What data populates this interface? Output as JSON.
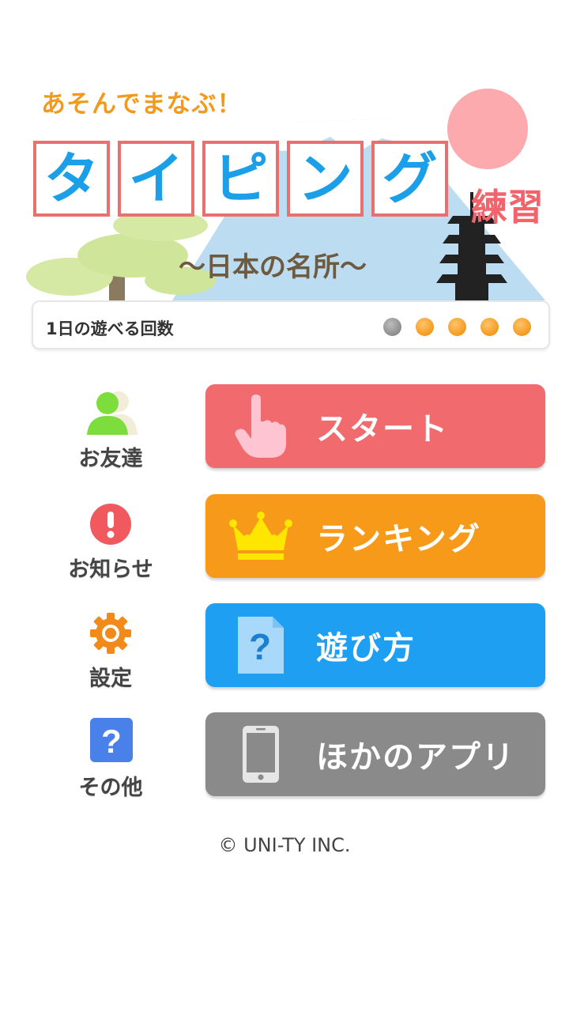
{
  "banner": {
    "tagline": "あそんでまなぶ！",
    "title_chars": [
      "タ",
      "イ",
      "ピ",
      "ン",
      "グ"
    ],
    "title_suffix": "練習",
    "subtitle": "〜日本の名所〜"
  },
  "play_count": {
    "label": "1日の遊べる回数",
    "used": 1,
    "total": 5
  },
  "side_menu": {
    "friends_label": "お友達",
    "news_label": "お知らせ",
    "settings_label": "設定",
    "other_label": "その他"
  },
  "buttons": {
    "start_label": "スタート",
    "ranking_label": "ランキング",
    "howto_label": "遊び方",
    "other_apps_label": "ほかのアプリ"
  },
  "footer": {
    "copyright": "© UNI-TY INC."
  },
  "colors": {
    "start": "#f16a6e",
    "ranking": "#f79a19",
    "howto": "#1e9ff1",
    "other_apps": "#8a8a8a",
    "title_text": "#1a9fe8",
    "title_border": "#ea7070"
  }
}
